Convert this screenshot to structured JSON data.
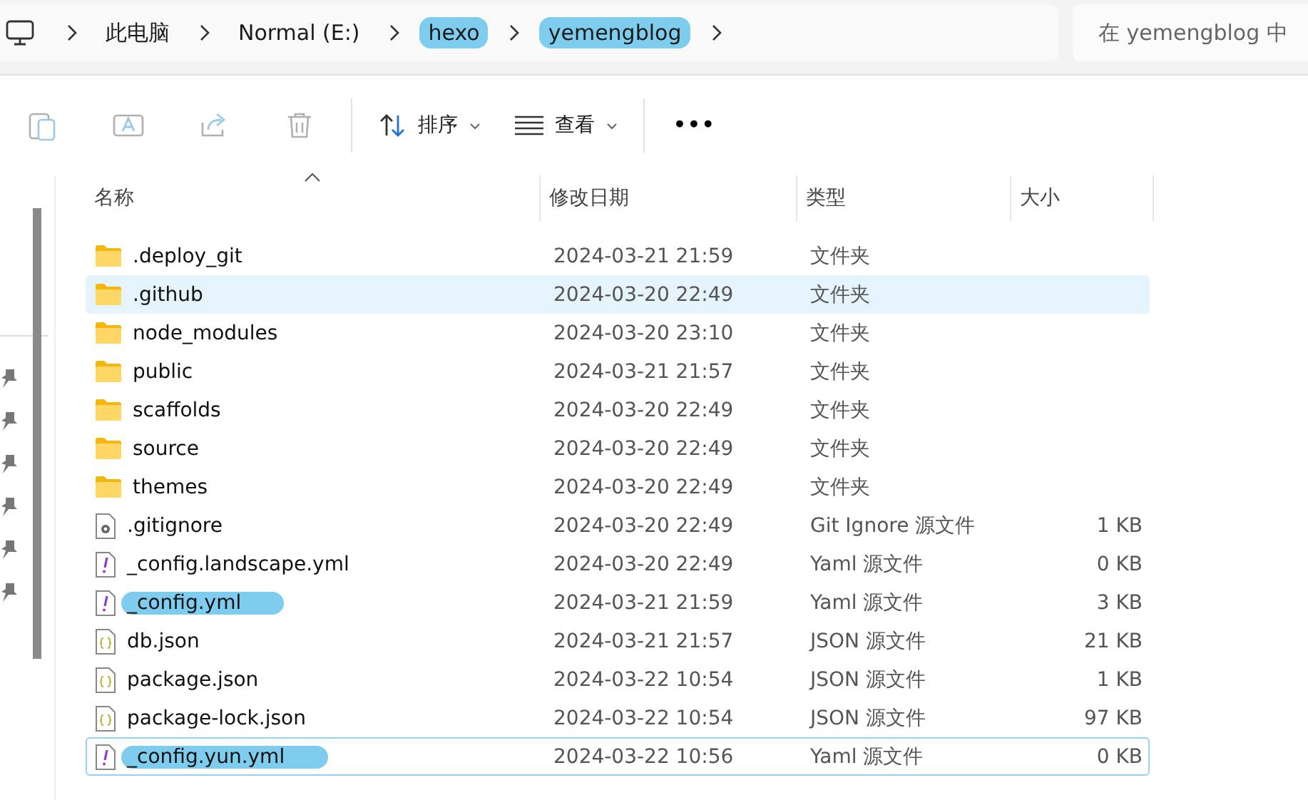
{
  "breadcrumb": [
    {
      "label": "此电脑",
      "marked": false
    },
    {
      "label": "Normal (E:)",
      "marked": false
    },
    {
      "label": "hexo",
      "marked": true
    },
    {
      "label": "yemengblog",
      "marked": true
    }
  ],
  "search": {
    "placeholder": "在 yemengblog 中"
  },
  "toolbar": [
    {
      "kind": "copy",
      "disabled": true
    },
    {
      "kind": "rename",
      "disabled": true
    },
    {
      "kind": "share",
      "disabled": true
    },
    {
      "kind": "delete",
      "disabled": true
    },
    {
      "kind": "sort",
      "label": "排序"
    },
    {
      "kind": "view",
      "label": "查看"
    },
    {
      "kind": "more",
      "label": "•••"
    }
  ],
  "columns": [
    {
      "label": "名称",
      "sorted": true
    },
    {
      "label": "修改日期",
      "sorted": false
    },
    {
      "label": "类型",
      "sorted": false
    },
    {
      "label": "大小",
      "sorted": false
    }
  ],
  "rows": [
    {
      "kind": "folder",
      "name": ".deploy_git",
      "date": "2024-03-21 21:59",
      "type": "文件夹",
      "hovered": false,
      "focused": false,
      "marked": false
    },
    {
      "kind": "folder",
      "name": ".github",
      "date": "2024-03-20 22:49",
      "type": "文件夹",
      "hovered": true,
      "focused": false,
      "marked": false
    },
    {
      "kind": "folder",
      "name": "node_modules",
      "date": "2024-03-20 23:10",
      "type": "文件夹",
      "hovered": false,
      "focused": false,
      "marked": false
    },
    {
      "kind": "folder",
      "name": "public",
      "date": "2024-03-21 21:57",
      "type": "文件夹",
      "hovered": false,
      "focused": false,
      "marked": false
    },
    {
      "kind": "folder",
      "name": "scaffolds",
      "date": "2024-03-20 22:49",
      "type": "文件夹",
      "hovered": false,
      "focused": false,
      "marked": false
    },
    {
      "kind": "folder",
      "name": "source",
      "date": "2024-03-20 22:49",
      "type": "文件夹",
      "hovered": false,
      "focused": false,
      "marked": false
    },
    {
      "kind": "folder",
      "name": "themes",
      "date": "2024-03-20 22:49",
      "type": "文件夹",
      "hovered": false,
      "focused": false,
      "marked": false
    },
    {
      "kind": "config",
      "name": ".gitignore",
      "date": "2024-03-20 22:49",
      "type": "Git Ignore 源文件",
      "size": "1 KB",
      "hovered": false,
      "focused": false,
      "marked": false
    },
    {
      "kind": "yaml",
      "name": "_config.landscape.yml",
      "date": "2024-03-20 22:49",
      "type": "Yaml 源文件",
      "size": "0 KB",
      "hovered": false,
      "focused": false,
      "marked": false
    },
    {
      "kind": "yaml",
      "name": "_config.yml",
      "date": "2024-03-21 21:59",
      "type": "Yaml 源文件",
      "size": "3 KB",
      "hovered": false,
      "focused": false,
      "marked": true
    },
    {
      "kind": "json",
      "name": "db.json",
      "date": "2024-03-21 21:57",
      "type": "JSON 源文件",
      "size": "21 KB",
      "hovered": false,
      "focused": false,
      "marked": false
    },
    {
      "kind": "json",
      "name": "package.json",
      "date": "2024-03-22 10:54",
      "type": "JSON 源文件",
      "size": "1 KB",
      "hovered": false,
      "focused": false,
      "marked": false
    },
    {
      "kind": "json",
      "name": "package-lock.json",
      "date": "2024-03-22 10:54",
      "type": "JSON 源文件",
      "size": "97 KB",
      "hovered": false,
      "focused": false,
      "marked": false
    },
    {
      "kind": "yaml",
      "name": "_config.yun.yml",
      "date": "2024-03-22 10:56",
      "type": "Yaml 源文件",
      "size": "0 KB",
      "hovered": false,
      "focused": true,
      "marked": true
    }
  ]
}
